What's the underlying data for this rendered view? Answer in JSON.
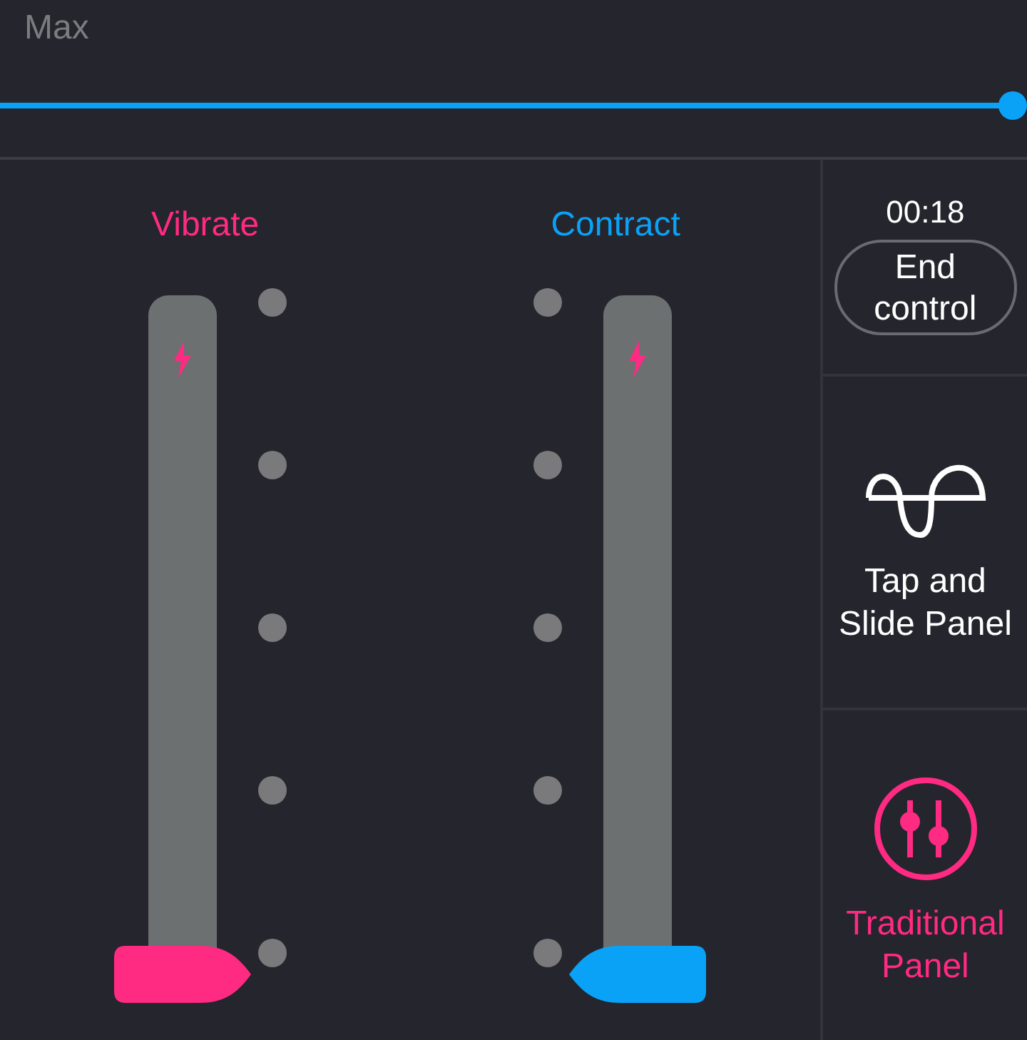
{
  "intensity": {
    "label": "Max",
    "level": 1.0
  },
  "channels": [
    {
      "name": "Vibrate",
      "color": "#ff2a82",
      "kind": "trailing",
      "level": 0
    },
    {
      "name": "Contract",
      "color": "#0aa2f7",
      "kind": "leading",
      "level": 0
    }
  ],
  "sidebar": {
    "timer": "00:18",
    "end_button": "End control",
    "modes": [
      {
        "label": "Tap and Slide Panel",
        "kind": "wave",
        "selected": false
      },
      {
        "label": "Traditional Panel",
        "kind": "sliders",
        "selected": true
      }
    ]
  }
}
